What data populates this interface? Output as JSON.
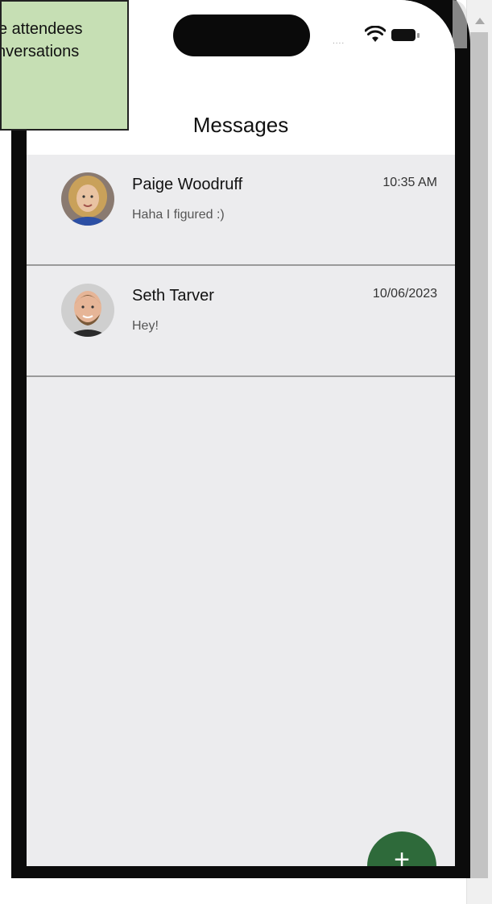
{
  "callout": {
    "line1": "e attendees",
    "line2": "nversations"
  },
  "header": {
    "title": "Messages"
  },
  "status_bar": {
    "signal": "....",
    "wifi": "wifi-icon",
    "battery": "battery-icon"
  },
  "conversations": [
    {
      "name": "Paige Woodruff",
      "preview": "Haha I figured :)",
      "time": "10:35 AM",
      "avatar": "avatar-paige"
    },
    {
      "name": "Seth Tarver",
      "preview": "Hey!",
      "time": "10/06/2023",
      "avatar": "avatar-seth"
    }
  ],
  "fab": {
    "label": "+",
    "color": "#2e6a3a"
  },
  "colors": {
    "screen_background": "#ececee",
    "callout_background": "#c6dfb4"
  }
}
